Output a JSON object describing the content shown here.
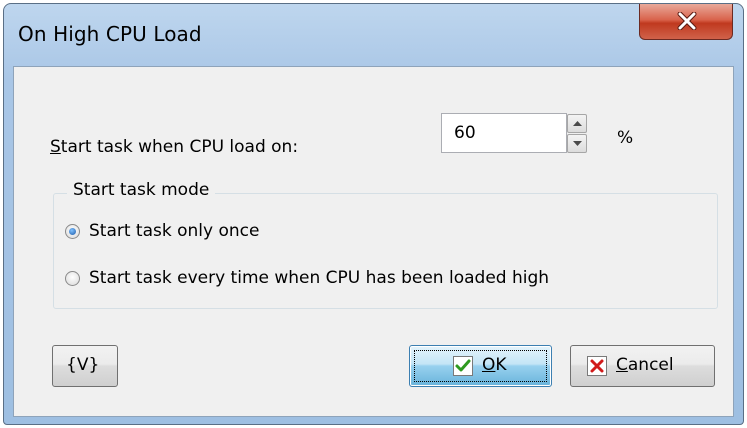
{
  "window": {
    "title": "On High CPU Load",
    "close_label": "x"
  },
  "cpu": {
    "label_accesskey": "S",
    "label_rest": "tart task when CPU load on:",
    "value": "60",
    "unit": "%"
  },
  "mode": {
    "group_label": "Start task mode",
    "options": [
      {
        "label": "Start task only once",
        "selected": true
      },
      {
        "label": "Start task every time when CPU has been loaded high",
        "selected": false
      }
    ]
  },
  "buttons": {
    "variables_label": "{V}",
    "ok_accesskey": "O",
    "ok_rest": "K",
    "cancel_accesskey": "C",
    "cancel_rest": "ancel"
  },
  "icons": {
    "close": "close-icon",
    "spin_up": "spin-up-arrow-icon",
    "spin_down": "spin-down-arrow-icon",
    "ok": "check-icon",
    "cancel": "x-mark-icon"
  },
  "colors": {
    "title_bar": "#a9c6e6",
    "close_button": "#c0391f",
    "ok_check": "#2e9a1f",
    "cancel_x": "#d11a1a",
    "radio_dot": "#1d5aa8"
  }
}
